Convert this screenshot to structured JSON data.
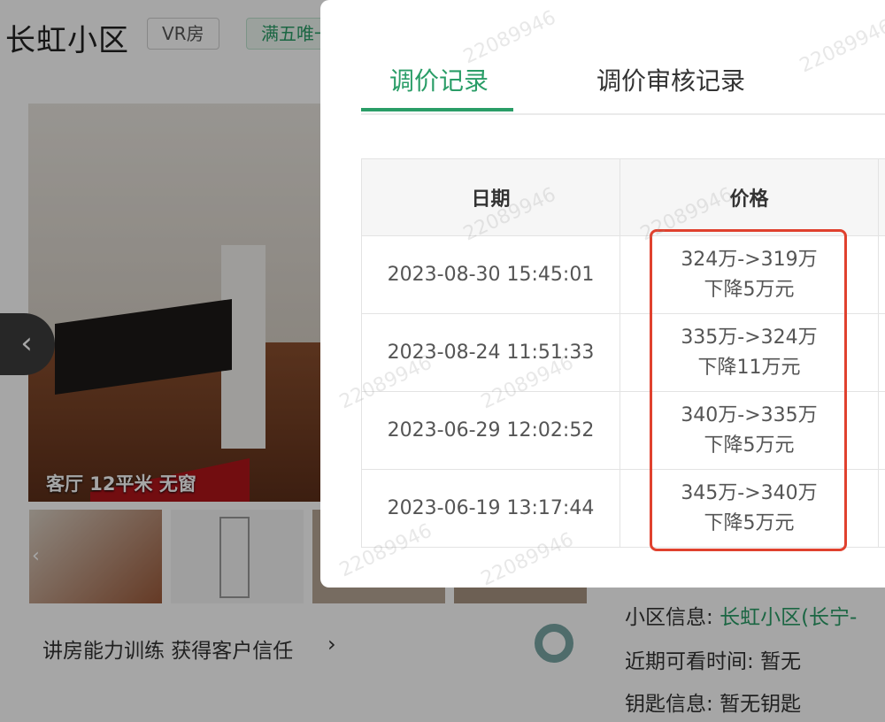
{
  "background": {
    "listing_title": "长虹小区",
    "tags": [
      "VR房",
      "满五唯一"
    ],
    "photo_caption": "客厅 12平米 无窗",
    "gallery_prev_icon": "chevron-left-icon",
    "training_link": "讲房能力训练 获得客户信任",
    "info": {
      "community_label": "小区信息:",
      "community_value": "长虹小区(长宁-",
      "visit_label": "近期可看时间:",
      "visit_value": "暂无",
      "key_label": "钥匙信息:",
      "key_value": "暂无钥匙"
    }
  },
  "modal": {
    "tabs": [
      {
        "label": "调价记录",
        "active": true
      },
      {
        "label": "调价审核记录",
        "active": false
      }
    ],
    "table": {
      "headers": [
        "日期",
        "价格"
      ],
      "rows": [
        {
          "date": "2023-08-30 15:45:01",
          "change": "324万->319万",
          "drop": "下降5万元"
        },
        {
          "date": "2023-08-24 11:51:33",
          "change": "335万->324万",
          "drop": "下降11万元"
        },
        {
          "date": "2023-06-29 12:02:52",
          "change": "340万->335万",
          "drop": "下降5万元"
        },
        {
          "date": "2023-06-19 13:17:44",
          "change": "345万->340万",
          "drop": "下降5万元"
        }
      ]
    }
  },
  "watermark": "22089946",
  "colors": {
    "accent": "#2a9d67",
    "highlight": "#e0412e"
  }
}
